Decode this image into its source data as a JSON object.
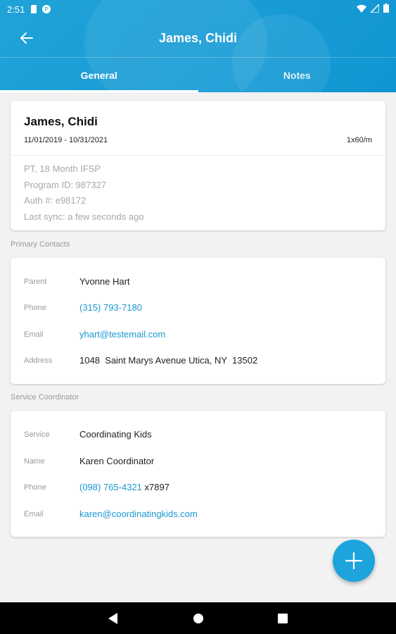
{
  "status_bar": {
    "time": "2:51"
  },
  "header": {
    "title": "James, Chidi"
  },
  "tabs": [
    {
      "label": "General",
      "active": true
    },
    {
      "label": "Notes",
      "active": false
    }
  ],
  "summary": {
    "name": "James, Chidi",
    "dates": "11/01/2019 - 10/31/2021",
    "frequency": "1x60/m",
    "lines": [
      "PT, 18 Month IFSP",
      "Program ID: 987327",
      "Auth #: e98172",
      "Last sync: a few seconds ago"
    ]
  },
  "primary_contacts": {
    "section_label": "Primary Contacts",
    "parent_label": "Parent",
    "parent_value": "Yvonne Hart",
    "phone_label": "Phone",
    "phone_value": "(315) 793-7180",
    "email_label": "Email",
    "email_value": "yhart@testemail.com",
    "address_label": "Address",
    "address_value": "1048  Saint Marys Avenue Utica, NY  13502"
  },
  "service_coordinator": {
    "section_label": "Service Coordinator",
    "service_label": "Service",
    "service_value": "Coordinating Kids",
    "name_label": "Name",
    "name_value": "Karen Coordinator",
    "phone_label": "Phone",
    "phone_value": "(098) 765-4321",
    "phone_ext": " x7897",
    "email_label": "Email",
    "email_value": "karen@coordinatingkids.com"
  },
  "colors": {
    "accent": "#1da4dc",
    "link": "#1b98d1"
  }
}
